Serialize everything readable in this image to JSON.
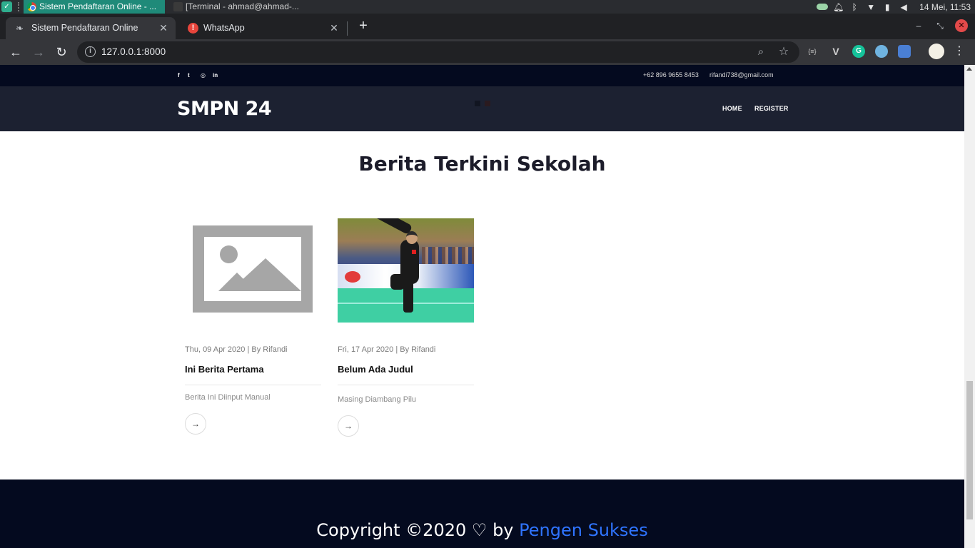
{
  "taskbar": {
    "tasks": [
      {
        "label": "Sistem Pendaftaran Online - ..."
      },
      {
        "label": "[Terminal - ahmad@ahmad-..."
      }
    ],
    "clock": "14 Mei, 11:53"
  },
  "browser": {
    "tabs": [
      {
        "title": "Sistem Pendaftaran Online",
        "active": true
      },
      {
        "title": "WhatsApp",
        "active": false
      }
    ],
    "url": "127.0.0.1:8000",
    "extensions": [
      "{≡}",
      "V",
      "G"
    ]
  },
  "page": {
    "topbar": {
      "social": [
        "f",
        "t",
        "◎",
        "in"
      ],
      "phone": "+62 896 9655 8453",
      "email": "rifandi738@gmail.com"
    },
    "brand": "SMPN 24",
    "nav": [
      {
        "label": "HOME"
      },
      {
        "label": "REGISTER"
      }
    ],
    "section_title": "Berita Terkini Sekolah",
    "news": [
      {
        "meta": "Thu, 09 Apr 2020 | By Rifandi",
        "title": "Ini Berita Pertama",
        "excerpt": "Berita Ini Diinput Manual",
        "image": "placeholder-image"
      },
      {
        "meta": "Fri, 17 Apr 2020 | By Rifandi",
        "title": "Belum Ada Judul",
        "excerpt": "Masing Diambang Pilu",
        "image": "pencak-silat-photo"
      }
    ],
    "footer": {
      "copyright_prefix": "Copyright ©2020",
      "heart": "♡",
      "by": "by",
      "link": "Pengen Sukses"
    }
  },
  "colors": {
    "topbar_bg": "#040a1f",
    "nav_bg": "#1c2131",
    "footer_link": "#2f74ff"
  }
}
